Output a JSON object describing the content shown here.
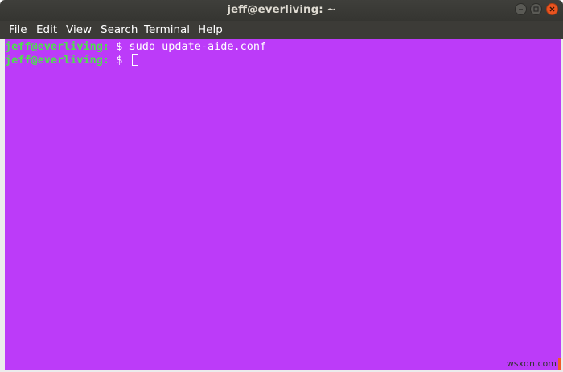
{
  "window": {
    "title": "jeff@everliving: ~"
  },
  "menu": {
    "items": [
      "File",
      "Edit",
      "View",
      "Search",
      "Terminal",
      "Help"
    ]
  },
  "terminal": {
    "lines": [
      {
        "user_host": "jeff@everliving",
        "path": ":",
        "prompt": " $ ",
        "command": "sudo update-aide.conf"
      },
      {
        "user_host": "jeff@everliving",
        "path": ":",
        "prompt": " $ ",
        "command": ""
      }
    ]
  },
  "watermark": "wsxdn.com",
  "colors": {
    "terminal_bg": "#bc3bf9",
    "user_host": "#4ee04e",
    "titlebar": "#3c3b37",
    "close_button": "#e95420"
  }
}
